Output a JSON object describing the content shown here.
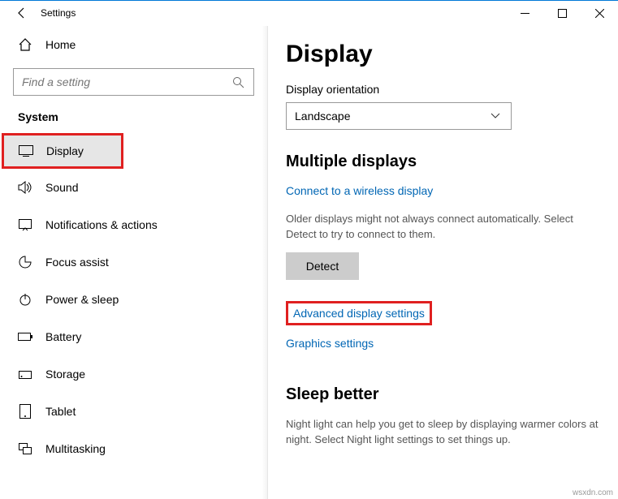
{
  "window": {
    "title": "Settings"
  },
  "sidebar": {
    "home": "Home",
    "searchPlaceholder": "Find a setting",
    "section": "System",
    "items": [
      {
        "label": "Display"
      },
      {
        "label": "Sound"
      },
      {
        "label": "Notifications & actions"
      },
      {
        "label": "Focus assist"
      },
      {
        "label": "Power & sleep"
      },
      {
        "label": "Battery"
      },
      {
        "label": "Storage"
      },
      {
        "label": "Tablet"
      },
      {
        "label": "Multitasking"
      }
    ]
  },
  "main": {
    "title": "Display",
    "orientation": {
      "label": "Display orientation",
      "value": "Landscape"
    },
    "multiple": {
      "heading": "Multiple displays",
      "wireless": "Connect to a wireless display",
      "detectDesc": "Older displays might not always connect automatically. Select Detect to try to connect to them.",
      "detect": "Detect",
      "advanced": "Advanced display settings",
      "graphics": "Graphics settings"
    },
    "sleep": {
      "heading": "Sleep better",
      "desc": "Night light can help you get to sleep by displaying warmer colors at night. Select Night light settings to set things up."
    }
  },
  "watermark": "wsxdn.com"
}
